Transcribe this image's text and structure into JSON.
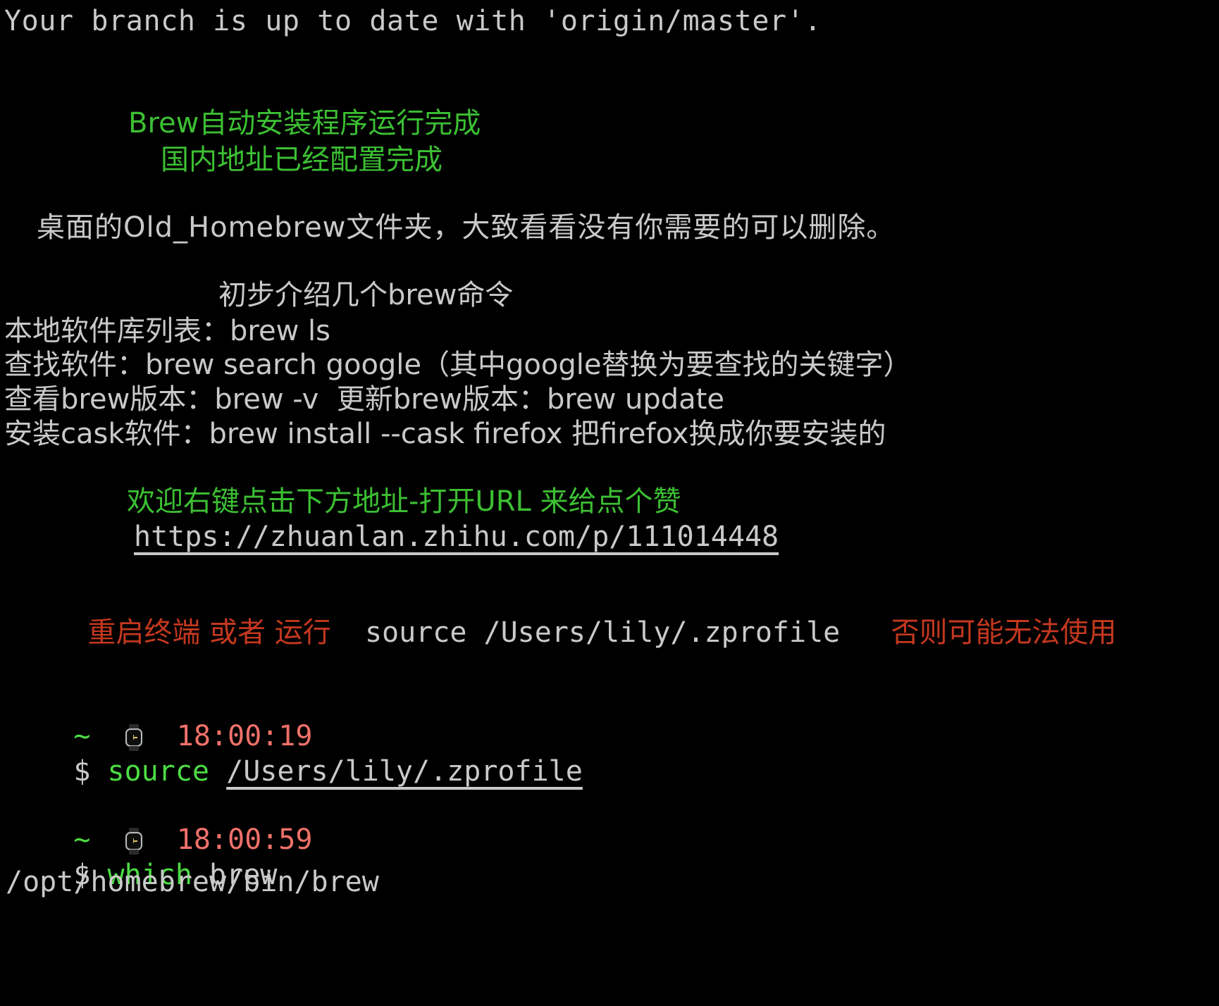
{
  "terminal": {
    "background": "#000000",
    "foreground": "#c9c9c9",
    "green": "#3cbf33",
    "bright_green": "#4ddb44",
    "red": "#c4381f",
    "salmon": "#f0716a"
  },
  "git_status": {
    "line": "Your branch is up to date with 'origin/master'."
  },
  "banner": {
    "line1": "Brew自动安装程序运行完成",
    "line2": "国内地址已经配置完成"
  },
  "notice": {
    "desktop_folder": "桌面的Old_Homebrew文件夹，大致看看没有你需要的可以删除。"
  },
  "commands": {
    "heading": "初步介绍几个brew命令",
    "items": [
      "本地软件库列表：brew ls",
      "查找软件：brew search google（其中google替换为要查找的关键字）",
      "查看brew版本：brew -v  更新brew版本：brew update",
      "安装cask软件：brew install --cask firefox 把firefox换成你要安装的"
    ]
  },
  "promo": {
    "invite": "欢迎右键点击下方地址-打开URL 来给点个赞",
    "url": "https://zhuanlan.zhihu.com/p/111014448"
  },
  "warning": {
    "prefix": "重启终端 或者 运行",
    "command": "source /Users/lily/.zprofile",
    "suffix": "否则可能无法使用"
  },
  "prompts": [
    {
      "cwd": "~",
      "clock_icon": "watch-icon",
      "time": "18:00:19",
      "sigil": "$",
      "command": "source",
      "argument": "/Users/lily/.zprofile",
      "output": ""
    },
    {
      "cwd": "~",
      "clock_icon": "watch-icon",
      "time": "18:00:59",
      "sigil": "$",
      "command": "which",
      "argument": "brew",
      "output": "/opt/homebrew/bin/brew"
    }
  ]
}
